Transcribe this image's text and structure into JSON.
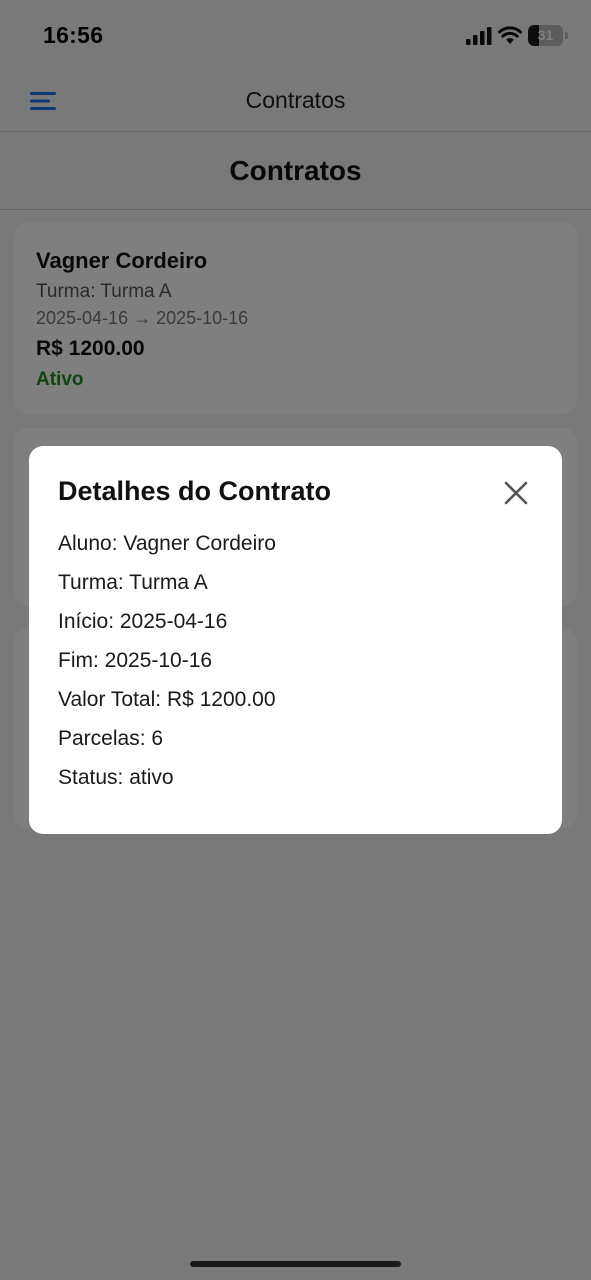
{
  "status_bar": {
    "time": "16:56",
    "battery": "31"
  },
  "nav": {
    "title": "Contratos",
    "menu_icon": "hamburger-menu-icon"
  },
  "page": {
    "title": "Contratos"
  },
  "contracts": [
    {
      "name": "Vagner Cordeiro",
      "turma": "Turma: Turma A",
      "dates": "2025-04-16 → 2025-10-16",
      "value": "R$ 1200.00",
      "status": "Ativo"
    }
  ],
  "modal": {
    "title": "Detalhes do Contrato",
    "close_icon": "close-icon",
    "lines": [
      "Aluno: Vagner Cordeiro",
      "Turma: Turma A",
      "Início: 2025-04-16",
      "Fim: 2025-10-16",
      "Valor Total: R$ 1200.00",
      "Parcelas: 6",
      "Status: ativo"
    ]
  },
  "colors": {
    "accent": "#1a73e8",
    "status_active": "#1e8a1e",
    "background": "#f2f2f2",
    "overlay": "rgba(0,0,0,0.5)"
  }
}
